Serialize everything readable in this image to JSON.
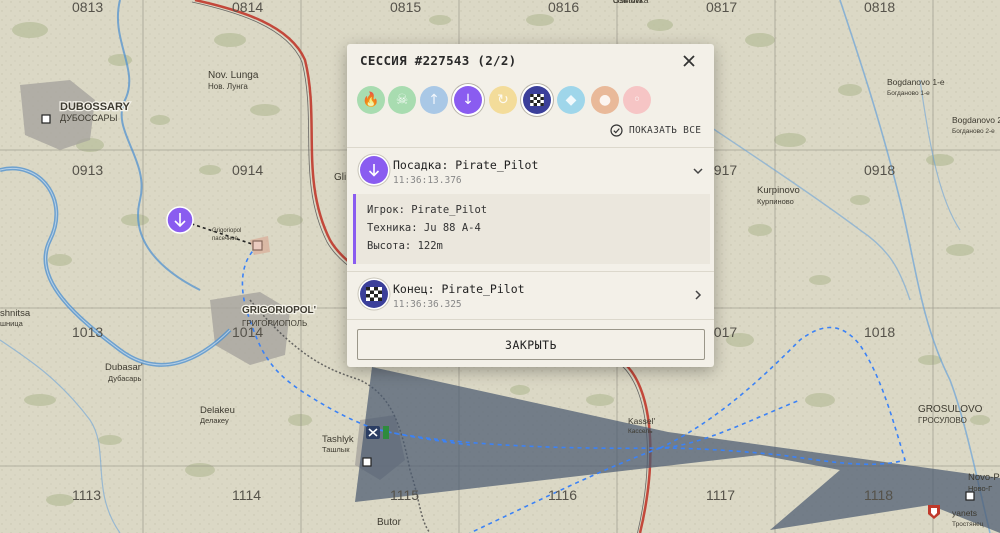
{
  "map": {
    "grid_labels": [
      "0813",
      "0814",
      "0815",
      "0816",
      "0817",
      "0818",
      "0913",
      "0914",
      "0917",
      "0918",
      "1013",
      "1014",
      "1017",
      "1018",
      "1113",
      "1114",
      "1115",
      "1116",
      "1117",
      "1118"
    ],
    "places": [
      {
        "name": "DUBOSSARY",
        "name_ru": "ДУБОССАРЫ"
      },
      {
        "name": "Nov. Lunga",
        "name_ru": "Нов. Лунга"
      },
      {
        "name": "GRIGORIOPOL'",
        "name_ru": "ГРИГОРИОПОЛЬ"
      },
      {
        "name": "Dubasar'",
        "name_ru": "Дубасарь"
      },
      {
        "name": "Delakeu",
        "name_ru": "Делакеу"
      },
      {
        "name": "Tashlyk",
        "name_ru": "Ташлык"
      },
      {
        "name": "Kassel'",
        "name_ru": "Кассель"
      },
      {
        "name": "GROSULOVO",
        "name_ru": "ГРОСУЛОВО"
      },
      {
        "name": "Kurpinovo",
        "name_ru": "Курпиново"
      },
      {
        "name": "Bogdanovo 1-e",
        "name_ru": "Богданово 1-е"
      },
      {
        "name": "Bogdanovo 2-e",
        "name_ru": "Богданово 2-е"
      },
      {
        "name": "Novo-P",
        "name_ru": "Ново-Г"
      },
      {
        "name": "Butor",
        "name_ru": ""
      },
      {
        "name": "Osinovka",
        "name_ru": "Осиновка"
      },
      {
        "name": "shnitsa",
        "name_ru": "шница"
      },
      {
        "name": "Gli",
        "name_ru": ""
      },
      {
        "name": "yanets",
        "name_ru": "Тростянец"
      },
      {
        "name": "Grigoriopol",
        "name_ru": "пасечное"
      }
    ],
    "colors": {
      "river": "#4a8fd0",
      "road": "#c0392b",
      "route": "#3b82f6",
      "zone": "#4b5a70"
    }
  },
  "modal": {
    "title": "СЕССИЯ #227543 (2/2)",
    "show_all": "ПОКАЗАТЬ ВСЕ",
    "filters": [
      {
        "icon": "flame-icon",
        "color": "#a8dcb0",
        "glyph": "🔥",
        "active": false
      },
      {
        "icon": "skull-icon",
        "color": "#a8dcb0",
        "glyph": "☠",
        "active": false
      },
      {
        "icon": "arrow-up-icon",
        "color": "#a9c8e6",
        "glyph": "↑",
        "active": false
      },
      {
        "icon": "arrow-down-icon",
        "color": "#8a5cf0",
        "glyph": "↓",
        "active": true
      },
      {
        "icon": "refresh-icon",
        "color": "#f3dc9a",
        "glyph": "↻",
        "active": false
      },
      {
        "icon": "checkered-flag-icon",
        "color": "#3b3f9a",
        "glyph": "",
        "active": true
      },
      {
        "icon": "diamond-icon",
        "color": "#9fd6ea",
        "glyph": "◆",
        "active": false
      },
      {
        "icon": "dot-icon",
        "color": "#e9b999",
        "glyph": "●",
        "active": false
      },
      {
        "icon": "ring-icon",
        "color": "#f6c5c5",
        "glyph": "◦",
        "active": false
      }
    ],
    "events": [
      {
        "title": "Посадка: Pirate_Pilot",
        "time": "11:36:13.376",
        "icon": "arrow-down-icon",
        "color": "#8a5cf0"
      },
      {
        "title": "Конец: Pirate_Pilot",
        "time": "11:36:36.325",
        "icon": "checkered-flag-icon",
        "color": "#3b3f9a"
      }
    ],
    "details": {
      "player": "Игрок: Pirate_Pilot",
      "vehicle": "Техника: Ju 88 A-4",
      "altitude": "Высота: 122m"
    },
    "close_button": "ЗАКРЫТЬ"
  }
}
